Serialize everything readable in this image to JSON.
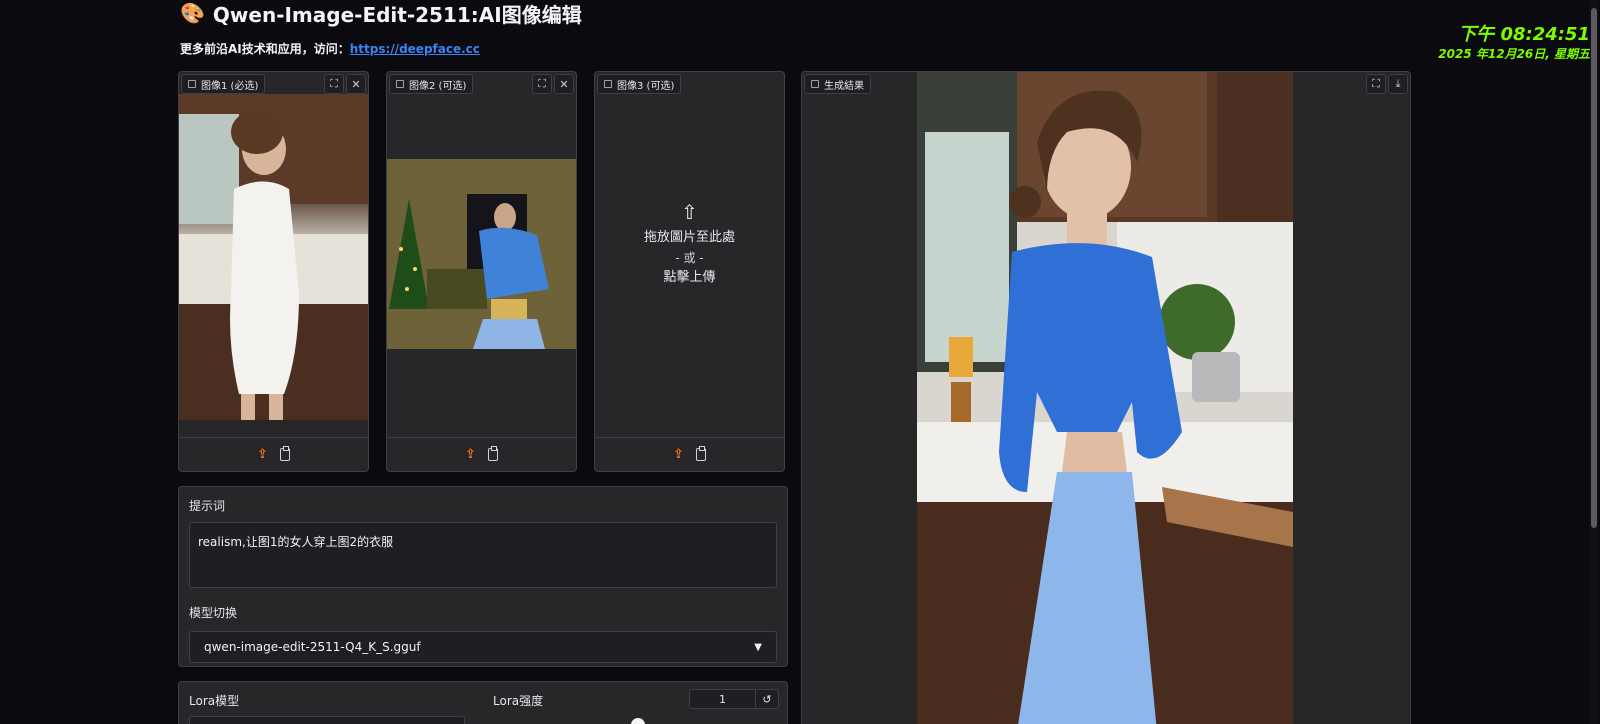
{
  "header": {
    "title": "Qwen-Image-Edit-2511:AI图像编辑",
    "subtitle_prefix": "更多前沿AI技术和应用，访问：",
    "subtitle_link": "https://deepface.cc"
  },
  "clock": {
    "time": "下午 08:24:51",
    "date": "2025 年12月26日, 星期五"
  },
  "inputs": {
    "image1_label": "图像1 (必选)",
    "image2_label": "图像2 (可选)",
    "image3_label": "图像3 (可选)",
    "drop_text": "拖放圖片至此處",
    "or_text": "- 或 -",
    "click_upload": "點擊上傳"
  },
  "prompt": {
    "label": "提示词",
    "value": "realism,让图1的女人穿上图2的衣服"
  },
  "model": {
    "label": "模型切换",
    "selected": "qwen-image-edit-2511-Q4_K_S.gguf"
  },
  "lora": {
    "model_label": "Lora模型",
    "strength_label": "Lora强度",
    "strength_value": "1",
    "strength_fraction": 0.5
  },
  "result": {
    "label": "生成結果"
  },
  "colors": {
    "accent": "#f97316",
    "link": "#3b82f6",
    "clock": "#7CFC00"
  }
}
